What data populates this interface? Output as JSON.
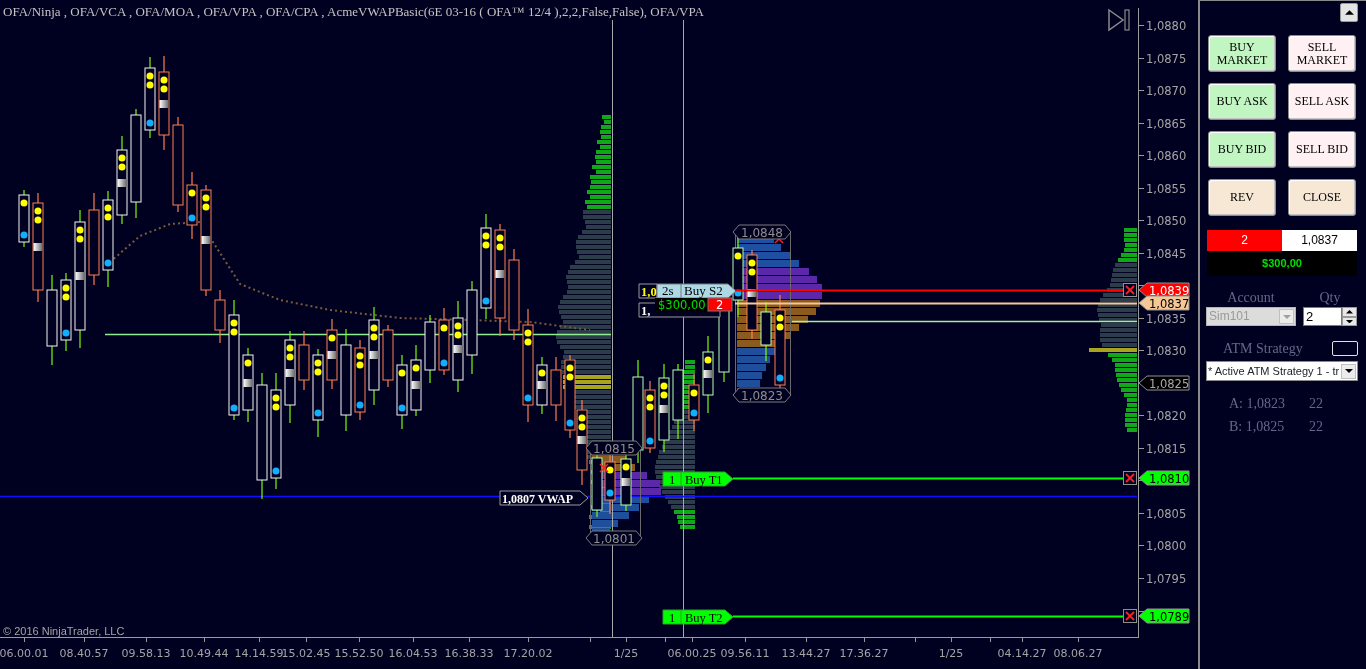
{
  "chart": {
    "title": "OFA/Ninja , OFA/VCA , OFA/MOA , OFA/VPA , OFA/CPA , AcmeVWAPBasic(6E 03-16 ( OFA™ 12/4 ),2,2,False,False), OFA/VPA",
    "price_axis": [
      "1,0880",
      "1,0875",
      "1,0870",
      "1,0865",
      "1,0860",
      "1,0855",
      "1,0850",
      "1,0845",
      "1,0835",
      "1,0830",
      "1,0820",
      "1,0815",
      "1,0805",
      "1,0800",
      "1,0795"
    ],
    "time_axis": [
      "06.00.01",
      "08.40.57",
      "09.58.13",
      "10.49.44",
      "14.14.59",
      "15.02.45",
      "15.52.50",
      "16.04.53",
      "16.38.33",
      "17.20.02",
      "1/25",
      "06.00.25",
      "09.56.11",
      "13.44.27",
      "17.36.27",
      "1/25",
      "04.14.27",
      "08.06.27"
    ],
    "price_tags": [
      {
        "text": "1,0839",
        "color": "#ff0000",
        "cancel": true,
        "line": true
      },
      {
        "text": "1,0837",
        "color": "#f5c896",
        "cancel": false,
        "line": true
      },
      {
        "text": "1,0825",
        "color": "#000000",
        "cancel": false,
        "line": false
      },
      {
        "text": "1,0810",
        "color": "#00ff00",
        "cancel": true,
        "line": true
      },
      {
        "text": "1,0789",
        "color": "#00ff00",
        "cancel": true,
        "line": true
      }
    ],
    "order_tags": [
      {
        "quantity": "1",
        "label": "Buy T1"
      },
      {
        "quantity": "1",
        "label": "Buy T2"
      }
    ],
    "position_tag": {
      "quantity": "2s",
      "label": "Buy S2"
    },
    "pnl_tag": {
      "pnl": "$300,00",
      "size": "2"
    },
    "level_labels": [
      {
        "text": "1,0",
        "color": "#ffff00"
      },
      {
        "text": "1,",
        "color": "#ffffff"
      },
      {
        "text": "1,0807 VWAP",
        "color": "#ffffff"
      }
    ],
    "range_labels": [
      "1,0848",
      "1,0823",
      "1,0815",
      "1,0801"
    ],
    "copyright": "© 2016 NinjaTrader, LLC"
  },
  "panel": {
    "buttons": [
      {
        "label": "BUY MARKET",
        "kind": "buy"
      },
      {
        "label": "SELL MARKET",
        "kind": "sell"
      },
      {
        "label": "BUY ASK",
        "kind": "buy"
      },
      {
        "label": "SELL ASK",
        "kind": "sell"
      },
      {
        "label": "BUY BID",
        "kind": "buy"
      },
      {
        "label": "SELL BID",
        "kind": "sell"
      },
      {
        "label": "REV",
        "kind": "neutral"
      },
      {
        "label": "CLOSE",
        "kind": "neutral"
      }
    ],
    "position": {
      "quantity": "2",
      "price": "1,0837",
      "pnl": "$300,00"
    },
    "account": {
      "label": "Account",
      "value": "Sim101",
      "disabled": true
    },
    "qty": {
      "label": "Qty",
      "value": "2"
    },
    "atm": {
      "label": "ATM Strategy",
      "value": "* Active ATM Strategy 1 - tr"
    },
    "quotes": [
      {
        "price": "A: 1,0823",
        "size": "22"
      },
      {
        "price": "B: 1,0825",
        "size": "22"
      }
    ]
  }
}
